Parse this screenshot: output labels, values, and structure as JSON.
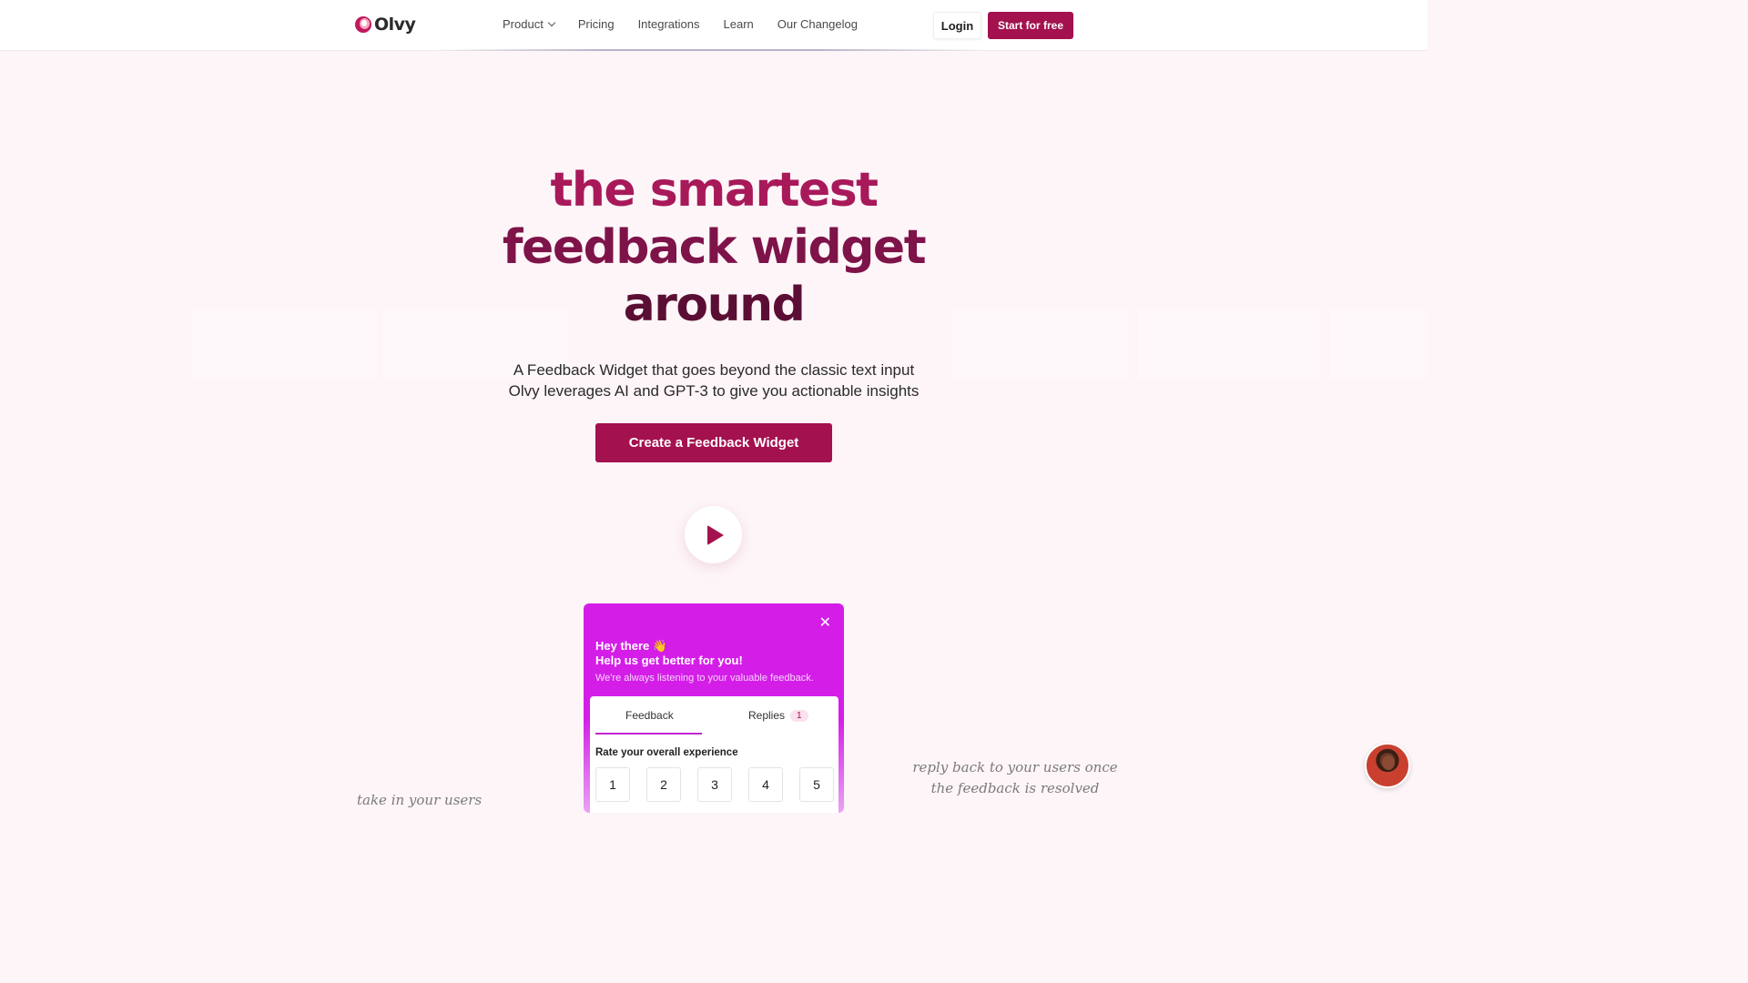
{
  "nav": {
    "logo_text": "Olvy",
    "links": [
      {
        "label": "Product",
        "has_dropdown": true
      },
      {
        "label": "Pricing"
      },
      {
        "label": "Integrations"
      },
      {
        "label": "Learn"
      },
      {
        "label": "Our Changelog"
      }
    ],
    "login_label": "Login",
    "start_label": "Start for free"
  },
  "hero": {
    "title_line1": "the smartest",
    "title_line2": "feedback widget",
    "title_line3": "around",
    "subtitle_line1": "A Feedback Widget that goes beyond the classic text input",
    "subtitle_line2": "Olvy leverages AI and GPT-3 to give you actionable insights",
    "cta_label": "Create a Feedback Widget",
    "play_icon": "play-icon"
  },
  "widget": {
    "close_icon": "close-icon",
    "heading1": "Hey there 👋",
    "heading2": "Help us get better for you!",
    "description": "We're always listening to your valuable feedback.",
    "tabs": [
      {
        "label": "Feedback",
        "active": true
      },
      {
        "label": "Replies",
        "badge": "1"
      }
    ],
    "rating_label": "Rate your overall experience",
    "rating_options": [
      "1",
      "2",
      "3",
      "4",
      "5"
    ]
  },
  "annotations": {
    "right_line1": "reply back to your users once",
    "right_line2": "the feedback is resolved",
    "left_partial": "take in your users"
  },
  "colors": {
    "brand": "#a4114f",
    "widget_accent": "#d41ee8",
    "background": "#fdf5f8"
  }
}
